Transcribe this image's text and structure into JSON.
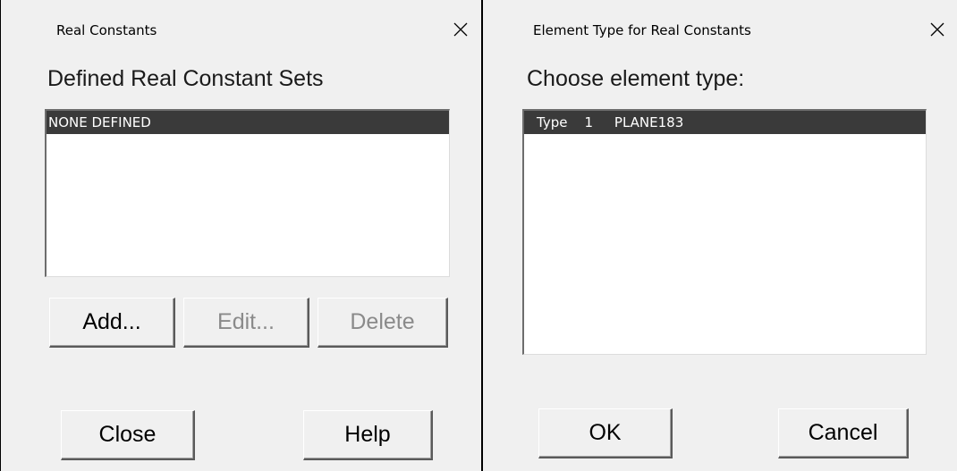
{
  "left_dialog": {
    "title": "Real Constants",
    "heading": "Defined Real Constant Sets",
    "list_items": [
      "NONE DEFINED"
    ],
    "buttons": {
      "add": "Add...",
      "edit": "Edit...",
      "delete": "Delete",
      "close": "Close",
      "help": "Help"
    }
  },
  "right_dialog": {
    "title": "Element Type for Real Constants",
    "heading": "Choose element type:",
    "list_items": [
      "Type    1     PLANE183"
    ],
    "buttons": {
      "ok": "OK",
      "cancel": "Cancel"
    }
  },
  "icons": {
    "close": "close-icon"
  },
  "colors": {
    "selection": "#3a3a3a",
    "background": "#f0f0f0"
  }
}
